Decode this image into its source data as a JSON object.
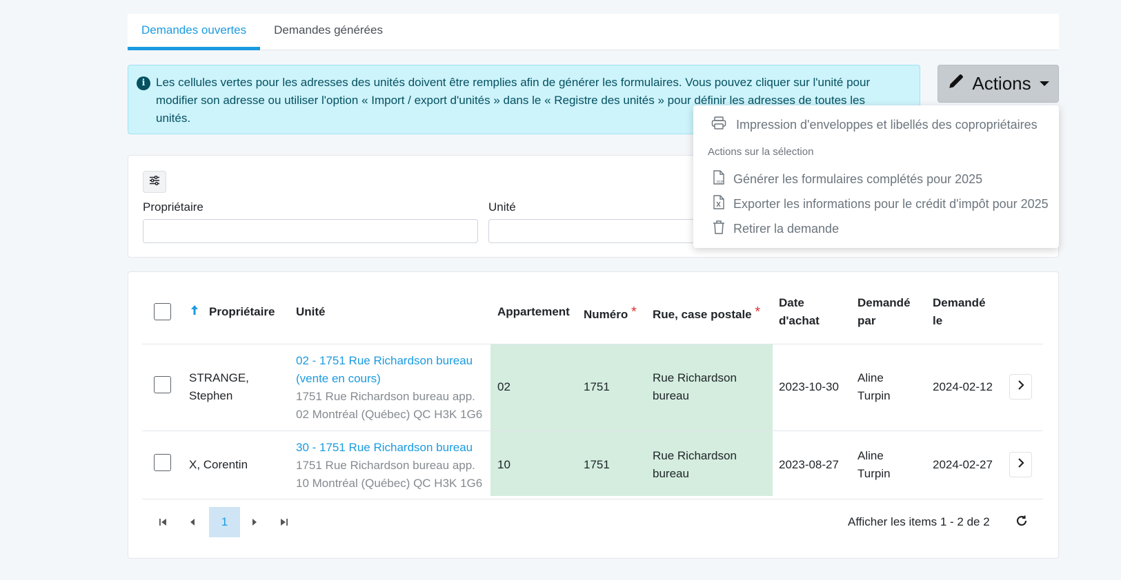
{
  "tabs": [
    {
      "label": "Demandes ouvertes",
      "active": true
    },
    {
      "label": "Demandes générées",
      "active": false
    }
  ],
  "alert": {
    "line1": "Les cellules vertes pour les adresses des unités doivent être remplies afin de générer les formulaires. Vous pouvez cliquer sur l'unité pour",
    "line2": "modifier son adresse ou utiliser l'option « Import / export d'unités » dans le « Registre des unités » pour définir les adresses de toutes les",
    "line3": "unités."
  },
  "actions": {
    "label": "Actions",
    "menu": {
      "print_label": "Impression d'enveloppes et libellés des copropriétaires",
      "section_header": "Actions sur la sélection",
      "generate_label": "Générer les formulaires complétés pour 2025",
      "export_label": "Exporter les informations pour le crédit d'impôt pour 2025",
      "remove_label": "Retirer la demande"
    }
  },
  "filters": {
    "owner_label": "Propriétaire",
    "unit_label": "Unité",
    "owner_value": "",
    "unit_value": ""
  },
  "table": {
    "headers": {
      "owner": "Propriétaire",
      "unit": "Unité",
      "apartment": "Appartement",
      "number": "Numéro",
      "street": "Rue, case postale",
      "purchase_l1": "Date",
      "purchase_l2": "d'achat",
      "requested_by_l1": "Demandé",
      "requested_by_l2": "par",
      "requested_on_l1": "Demandé",
      "requested_on_l2": "le",
      "required_mark": "*"
    },
    "rows": [
      {
        "owner_l1": "STRANGE,",
        "owner_l2": "Stephen",
        "unit_link_l1": "02 - 1751 Rue Richardson bureau",
        "unit_link_l2": "(vente en cours)",
        "unit_addr_l1": "1751 Rue Richardson bureau app.",
        "unit_addr_l2": "02 Montréal (Québec) QC H3K 1G6",
        "apartment": "02",
        "number": "1751",
        "street_l1": "Rue Richardson",
        "street_l2": "bureau",
        "purchase_date": "2023-10-30",
        "requested_by_l1": "Aline",
        "requested_by_l2": "Turpin",
        "requested_on": "2024-02-12"
      },
      {
        "owner_l1": "X, Corentin",
        "unit_link_l1": "30 - 1751 Rue Richardson bureau",
        "unit_addr_l1": "1751 Rue Richardson bureau app.",
        "unit_addr_l2": "10 Montréal (Québec) QC H3K 1G6",
        "apartment": "10",
        "number": "1751",
        "street_l1": "Rue Richardson",
        "street_l2": "bureau",
        "purchase_date": "2023-08-27",
        "requested_by_l1": "Aline",
        "requested_by_l2": "Turpin",
        "requested_on": "2024-02-27"
      }
    ]
  },
  "pagination": {
    "current_page": "1",
    "summary": "Afficher les items 1 - 2 de 2"
  },
  "colors": {
    "accent": "#1a9be0",
    "required_cell": "#d4eddf",
    "alert_bg": "#cdf3fb"
  },
  "icons": [
    "info-icon",
    "pencil-icon",
    "caret-down-icon",
    "filter-sliders-icon",
    "printer-icon",
    "pdf-file-icon",
    "excel-file-icon",
    "trash-icon",
    "sort-asc-icon",
    "chevron-right-icon",
    "first-page-icon",
    "prev-page-icon",
    "next-page-icon",
    "last-page-icon",
    "refresh-icon"
  ]
}
